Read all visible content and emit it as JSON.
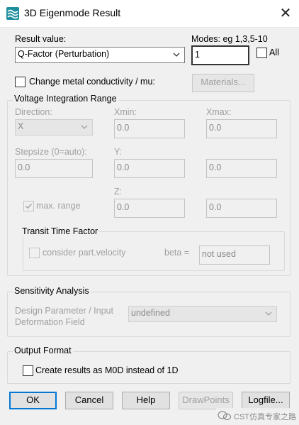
{
  "window": {
    "title": "3D Eigenmode Result",
    "close_label": "✕"
  },
  "result_value": {
    "label": "Result value:",
    "selected": "Q-Factor (Perturbation)"
  },
  "modes": {
    "label": "Modes: eg 1,3,5-10",
    "value": "1",
    "all_label": "All"
  },
  "change_metal": {
    "label": "Change metal conductivity / mu:",
    "materials_button": "Materials..."
  },
  "voltage_integration": {
    "title": "Voltage Integration Range",
    "direction_label": "Direction:",
    "direction_value": "X",
    "xmin_label": "Xmin:",
    "xmin_value": "0.0",
    "xmax_label": "Xmax:",
    "xmax_value": "0.0",
    "stepsize_label": "Stepsize (0=auto):",
    "stepsize_value": "0.0",
    "y_label": "Y:",
    "y_value": "0.0",
    "y2_value": "0.0",
    "max_range_label": "max. range",
    "z_label": "Z:",
    "z_value": "0.0",
    "z2_value": "0.0"
  },
  "transit_time": {
    "title": "Transit Time Factor",
    "consider_label": "consider part.velocity",
    "beta_label": "beta =",
    "beta_value": "not used"
  },
  "sensitivity": {
    "title": "Sensitivity Analysis",
    "param_label_line1": "Design Parameter / Input",
    "param_label_line2": "Deformation Field",
    "param_value": "undefined"
  },
  "output_format": {
    "title": "Output Format",
    "create_label": "Create results as M0D instead of 1D"
  },
  "buttons": {
    "ok": "OK",
    "cancel": "Cancel",
    "help": "Help",
    "drawpoints": "DrawPoints",
    "logfile": "Logfile..."
  },
  "watermark": {
    "text": "CST仿真专家之路"
  },
  "colors": {
    "accent": "#0078d7",
    "app_icon": "#1e8f9e"
  }
}
